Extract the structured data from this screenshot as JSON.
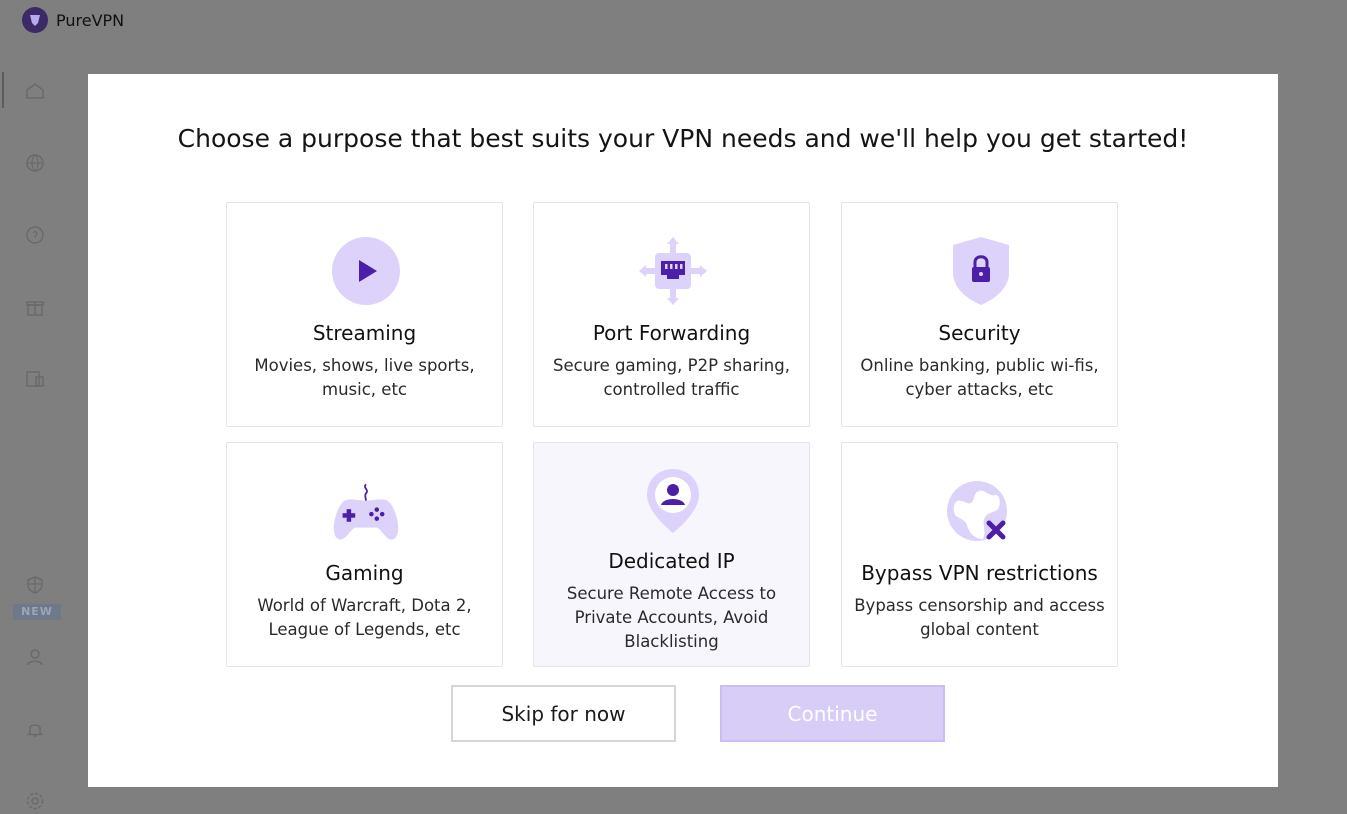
{
  "app": {
    "title": "PureVPN"
  },
  "sidebar": {
    "new_badge": "NEW"
  },
  "modal": {
    "heading": "Choose a purpose that best suits your VPN needs and we'll help you get started!",
    "cards": [
      {
        "title": "Streaming",
        "desc": "Movies, shows, live sports, music, etc",
        "icon": "play-icon"
      },
      {
        "title": "Port Forwarding",
        "desc": "Secure gaming, P2P sharing, controlled traffic",
        "icon": "port-icon"
      },
      {
        "title": "Security",
        "desc": "Online banking, public wi-fis, cyber attacks, etc",
        "icon": "shield-lock-icon"
      },
      {
        "title": "Gaming",
        "desc": "World of Warcraft, Dota 2, League of Legends, etc",
        "icon": "gamepad-icon"
      },
      {
        "title": "Dedicated IP",
        "desc": "Secure Remote Access to Private Accounts, Avoid Blacklisting",
        "icon": "location-user-icon"
      },
      {
        "title": "Bypass VPN restrictions",
        "desc": "Bypass censorship and access global content",
        "icon": "globe-blocked-icon"
      }
    ],
    "skip_label": "Skip for now",
    "continue_label": "Continue"
  },
  "colors": {
    "accent": "#4b1fa8",
    "accent_light": "#d9d0f7",
    "overlay": "#7f7f7f"
  }
}
